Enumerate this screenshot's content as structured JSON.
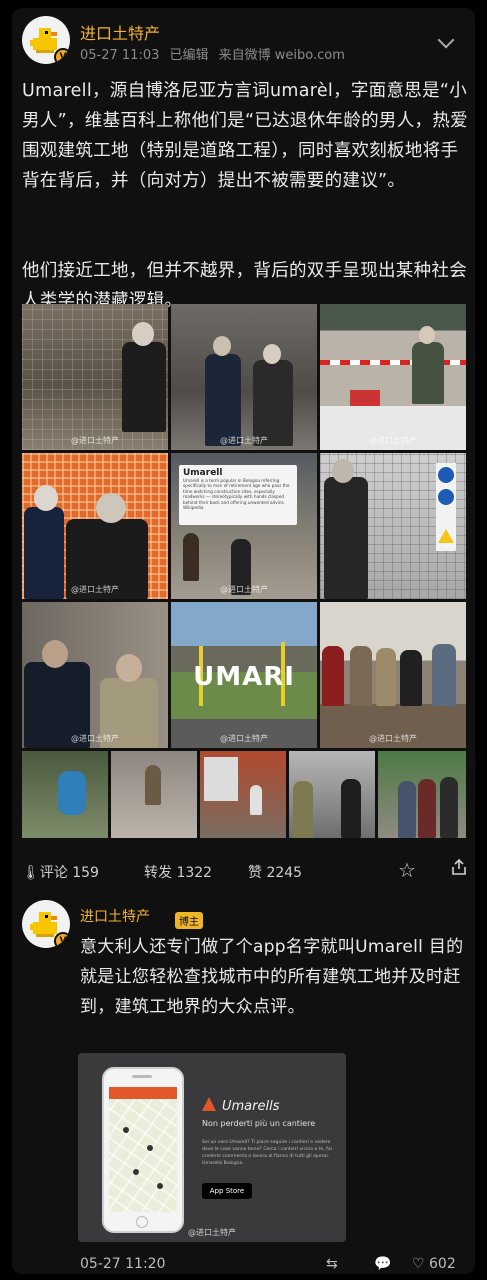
{
  "post": {
    "username": "进口土特产",
    "date": "05-27 11:03",
    "edited": "已编辑",
    "source": "来自微博 weibo.com",
    "paragraphs": [
      "Umarell，源自博洛尼亚方言词umarèl，字面意思是“小男人”，维基百科上称他们是“已达退休年龄的男人，热爱围观建筑工地（特别是道路工程），同时喜欢刻板地将手背在背后，并（向对方）提出不被需要的建议”。",
      "他们接近工地，但并不越界，背后的双手呈现出某种社会人类学的潜藏逻辑。"
    ]
  },
  "images": {
    "watermark": "@进口土特产",
    "overlay_title": "Umarell",
    "overlay_text": "Umarell is a term popular in Bologna referring specifically to men of retirement age who pass the time watching construction sites, especially roadworks — stereotypically with hands clasped behind their back and offering unwanted advice. Wikipedia",
    "sign_text": "UMARI",
    "app": {
      "title": "Umarells",
      "subtitle": "Non perderti più un cantiere",
      "body": "Sei un vero Umarell? Ti piace seguire i cantieri e vedere dove le cose vanno bene? Cerca i cantieri vicino a te, fai crederlo commenta e lavora al fianco di tutti gli operai. Umarells Bologna.",
      "store": "App Store"
    }
  },
  "actions": {
    "comments_label": "评论",
    "comments": "159",
    "reposts_label": "转发",
    "reposts": "1322",
    "likes_label": "赞",
    "likes": "2245"
  },
  "reply": {
    "username": "进口土特产",
    "badge": "博主",
    "text": "意大利人还专门做了个app名字就叫Umarell 目的就是让您轻松查找城市中的所有建筑工地并及时赶到，建筑工地界的大众点评。",
    "date": "05-27 11:20",
    "likes": "602"
  },
  "colors": {
    "accent": "#f0b429",
    "background": "#101010"
  }
}
